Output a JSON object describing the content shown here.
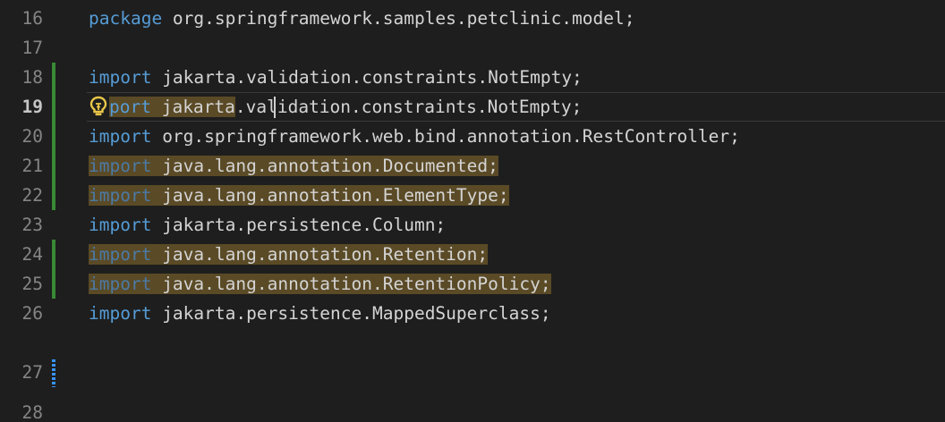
{
  "editor": {
    "lines": [
      {
        "num": "16",
        "kw": "package",
        "rest": " org.springframework.samples.petclinic.model;"
      },
      {
        "num": "17",
        "kw": "",
        "rest": ""
      },
      {
        "num": "18",
        "kw": "import",
        "rest": " jakarta.validation.constraints.NotEmpty;"
      },
      {
        "num": "19",
        "kw": "port",
        "rest_a": " jakarta",
        "rest_b": ".validation.constraints.NotEmpty;"
      },
      {
        "num": "20",
        "kw": "import",
        "rest": " org.springframework.web.bind.annotation.RestController;"
      },
      {
        "num": "21",
        "kw": "import",
        "rest": " java.lang.annotation.Documented;"
      },
      {
        "num": "22",
        "kw": "import",
        "rest": " java.lang.annotation.ElementType;"
      },
      {
        "num": "23",
        "kw": "import",
        "rest": " jakarta.persistence.Column;"
      },
      {
        "num": "24",
        "kw": "import",
        "rest": " java.lang.annotation.Retention;"
      },
      {
        "num": "25",
        "kw": "import",
        "rest": " java.lang.annotation.RetentionPolicy;"
      },
      {
        "num": "26",
        "kw": "import",
        "rest": " jakarta.persistence.MappedSuperclass;"
      },
      {
        "num": "27",
        "kw": "",
        "rest": ""
      },
      {
        "num": "28",
        "kw": "",
        "rest": ""
      }
    ],
    "colors": {
      "background": "#1e1e1e",
      "keyword": "#569cd6",
      "text": "#d4d4d4",
      "line_number": "#858585",
      "highlight": "#5a4a26",
      "added_bar": "#388a34",
      "modified_bar": "#3794ff",
      "lightbulb": "#e8c547"
    },
    "icons": {
      "quick_fix": "lightbulb-icon"
    }
  }
}
